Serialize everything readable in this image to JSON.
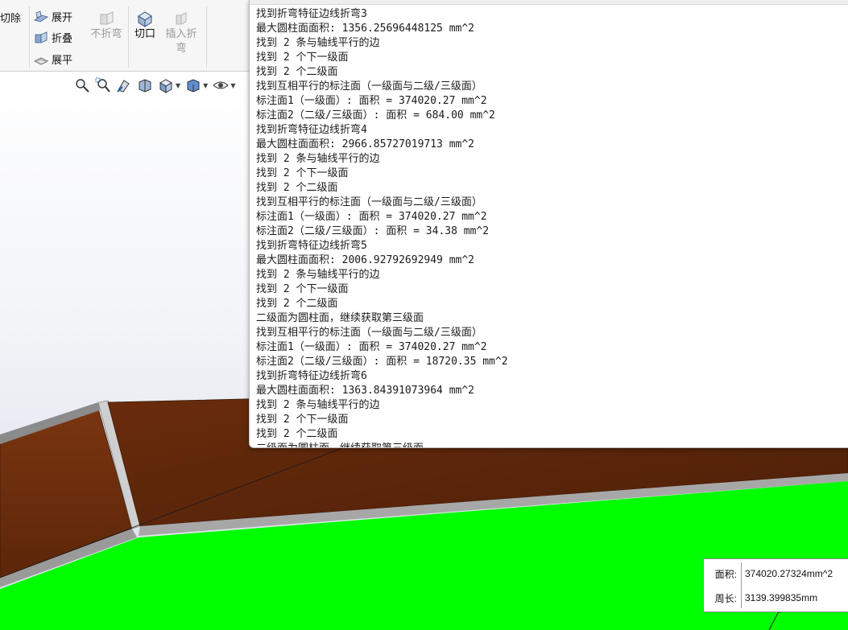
{
  "ribbon": {
    "cut_label": "切除",
    "unfold_label": "展开",
    "fold_label": "折叠",
    "flatten_label": "展平",
    "no_bends_label": "不折弯",
    "rip_label": "切口",
    "insert_bends_label_1": "插入折",
    "insert_bends_label_2": "弯"
  },
  "heads_up_icons": [
    "zoom-to-fit-icon",
    "zoom-area-icon",
    "previous-view-icon",
    "section-view-icon",
    "view-orientation-icon",
    "display-style-icon",
    "hide-show-items-icon"
  ],
  "colors": {
    "sheet_metal_brown": "#6e2f0c",
    "highlight_green": "#00ff00",
    "console_bg": "#ffffff"
  },
  "console": {
    "lines": [
      "找到折弯特征边线折弯3",
      "最大圆柱面面积: 1356.25696448125 mm^2",
      "找到 2 条与轴线平行的边",
      "找到 2 个下一级面",
      "找到 2 个二级面",
      "找到互相平行的标注面（一级面与二级/三级面）",
      "标注面1（一级面）: 面积 = 374020.27 mm^2",
      "标注面2（二级/三级面）: 面积 = 684.00 mm^2",
      "找到折弯特征边线折弯4",
      "最大圆柱面面积: 2966.85727019713 mm^2",
      "找到 2 条与轴线平行的边",
      "找到 2 个下一级面",
      "找到 2 个二级面",
      "找到互相平行的标注面（一级面与二级/三级面）",
      "标注面1（一级面）: 面积 = 374020.27 mm^2",
      "标注面2（二级/三级面）: 面积 = 34.38 mm^2",
      "找到折弯特征边线折弯5",
      "最大圆柱面面积: 2006.92792692949 mm^2",
      "找到 2 条与轴线平行的边",
      "找到 2 个下一级面",
      "找到 2 个二级面",
      "二级面为圆柱面，继续获取第三级面",
      "找到互相平行的标注面（一级面与二级/三级面）",
      "标注面1（一级面）: 面积 = 374020.27 mm^2",
      "标注面2（二级/三级面）: 面积 = 18720.35 mm^2",
      "找到折弯特征边线折弯6",
      "最大圆柱面面积: 1363.84391073964 mm^2",
      "找到 2 条与轴线平行的边",
      "找到 2 个下一级面",
      "找到 2 个二级面",
      "二级面为圆柱面，继续获取第三级面"
    ]
  },
  "measure": {
    "area_label": "面积:",
    "area_value": "374020.27324mm^2",
    "perimeter_label": "周长:",
    "perimeter_value": "3139.399835mm"
  }
}
